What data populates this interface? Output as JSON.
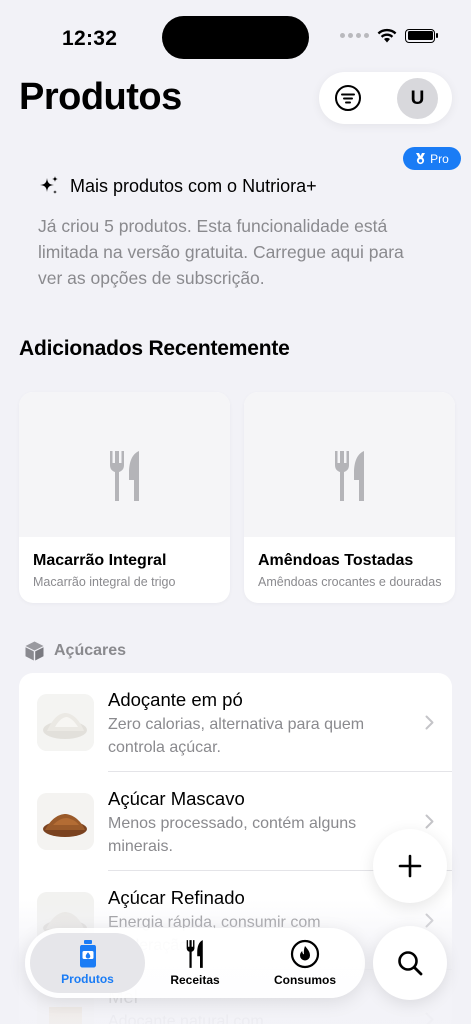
{
  "status_bar": {
    "time": "12:32"
  },
  "header": {
    "title": "Produtos",
    "avatar_initial": "U"
  },
  "promo": {
    "badge": "Pro",
    "title": "Mais produtos com o Nutriora+",
    "text": "Já criou 5 produtos. Esta funcionalidade está limitada na versão gratuita. Carregue aqui para ver as opções de subscrição."
  },
  "recent": {
    "section_title": "Adicionados Recentemente",
    "cards": [
      {
        "title": "Macarrão Integral",
        "subtitle": "Macarrão integral de trigo"
      },
      {
        "title": "Amêndoas Tostadas",
        "subtitle": "Amêndoas crocantes e douradas"
      }
    ]
  },
  "category": {
    "label": "Açúcares",
    "icon": "cube-icon"
  },
  "products": [
    {
      "title": "Adoçante em pó",
      "description": "Zero calorias, alternativa para quem controla açúcar.",
      "thumb_color": "#e9e7e2"
    },
    {
      "title": "Açúcar Mascavo",
      "description": "Menos processado, contém alguns minerais.",
      "thumb_color": "#9a5a2a"
    },
    {
      "title": "Açúcar Refinado",
      "description": "Energia rápida, consumir com moderação.",
      "thumb_color": "#eceae6"
    },
    {
      "title": "Mel",
      "description": "Adoçante natural com",
      "thumb_color": "#d9a441"
    }
  ],
  "tab_bar": {
    "tabs": [
      {
        "label": "Produtos",
        "icon": "bottle-icon",
        "active": true
      },
      {
        "label": "Receitas",
        "icon": "fork-knife-icon",
        "active": false
      },
      {
        "label": "Consumos",
        "icon": "flame-icon",
        "active": false
      }
    ]
  },
  "colors": {
    "accent": "#1a7cf5",
    "background": "#f2f2f7",
    "secondary_text": "#8a8a8e"
  }
}
